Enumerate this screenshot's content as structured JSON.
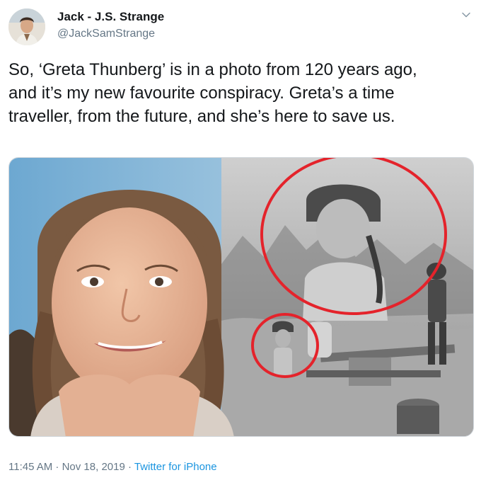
{
  "tweet": {
    "display_name": "Jack - J.S. Strange",
    "handle": "@JackSamStrange",
    "text": "So, ‘Greta Thunberg’ is in a photo from 120 years ago,\nand it’s my new favourite conspiracy. Greta’s a time\ntraveller, from the future, and she’s here to save us.",
    "timestamp": "11:45 AM · Nov 18, 2019",
    "separator": " · ",
    "source": "Twitter for iPhone"
  },
  "icons": {
    "menu": "chevron-down-icon",
    "avatar": "avatar"
  },
  "colors": {
    "handle": "#657786",
    "link": "#1b95e0",
    "highlight_circle": "#e4232b"
  }
}
